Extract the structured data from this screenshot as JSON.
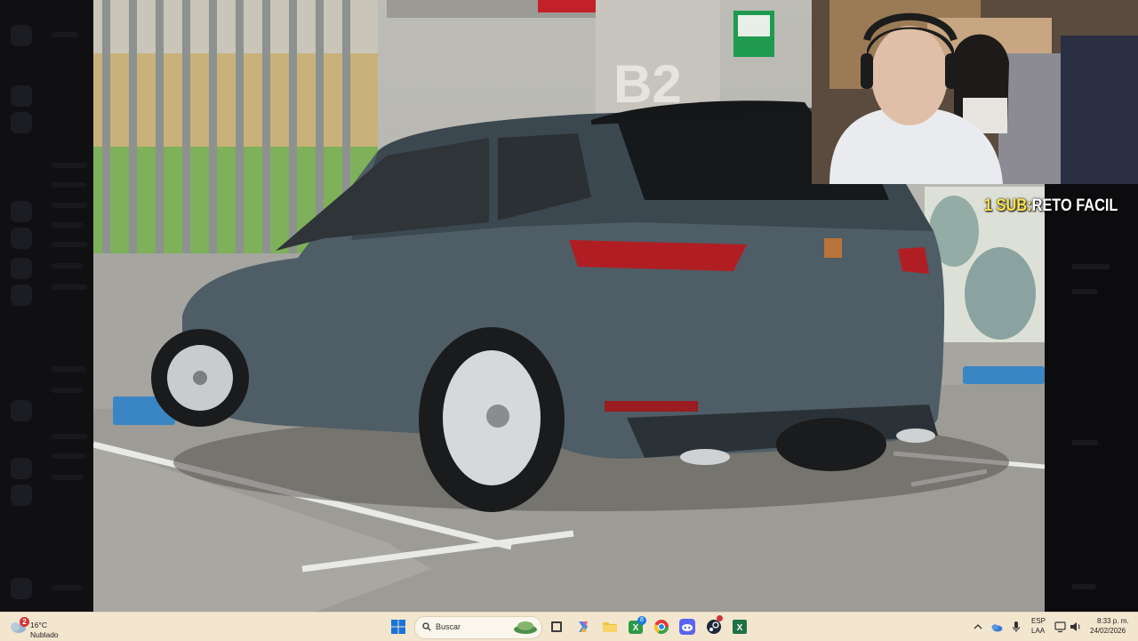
{
  "stream_overlay": {
    "goal_count": "1 SUB:",
    "goal_text": "RETO FACIL"
  },
  "photo": {
    "subject": "car-photo",
    "colors": {
      "car_body": "#4f5d66",
      "wall": "#b9b8b2",
      "floor": "#a7a6a0",
      "taillight": "#b01e24"
    }
  },
  "taskbar": {
    "weather": {
      "badge": "2",
      "temperature": "16°C",
      "condition": "Nublado"
    },
    "search": {
      "placeholder": "Buscar"
    },
    "apps": [
      "start",
      "file-explorer",
      "copilot",
      "folder",
      "xbox",
      "chrome",
      "discord",
      "steam",
      "excel"
    ],
    "xbox_badge": "8",
    "tray": {
      "language": "ESP",
      "keyboard": "LAA",
      "time": "8:33 p. m.",
      "date": "24/02/2026"
    }
  }
}
